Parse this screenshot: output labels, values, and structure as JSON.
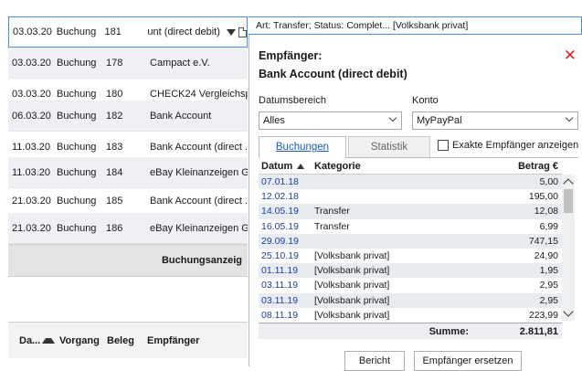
{
  "background": {
    "rows": [
      {
        "date": "03.03.20",
        "type": "Buchung",
        "num": "181",
        "payee": "unt (direct debit)"
      },
      {
        "date": "03.03.20",
        "type": "Buchung",
        "num": "178",
        "payee": "Campact e.V."
      },
      {
        "date": "03.03.20",
        "type": "Buchung",
        "num": "180",
        "payee": "CHECK24 Vergleichsp..."
      },
      {
        "date": "06.03.20",
        "type": "Buchung",
        "num": "182",
        "payee": "Bank Account"
      },
      {
        "date": "11.03.20",
        "type": "Buchung",
        "num": "183",
        "payee": "Bank Account (direct ..."
      },
      {
        "date": "11.03.20",
        "type": "Buchung",
        "num": "184",
        "payee": "eBay Kleinanzeigen G..."
      },
      {
        "date": "21.03.20",
        "type": "Buchung",
        "num": "185",
        "payee": "Bank Account (direct ..."
      },
      {
        "date": "21.03.20",
        "type": "Buchung",
        "num": "186",
        "payee": "eBay Kleinanzeigen G..."
      }
    ],
    "band_label": "Buchungsanzeig",
    "header": {
      "col1": "Da...",
      "col2": "Vorgang",
      "col3": "Beleg",
      "col4": "Empfänger"
    },
    "info_text": "Art: Transfer; Status: Complet...   [Volksbank privat]"
  },
  "popup": {
    "title": "Empfänger:",
    "subtitle": "Bank Account (direct debit)",
    "range_label": "Datumsbereich",
    "range_value": "Alles",
    "account_label": "Konto",
    "account_value": "MyPayPal",
    "tab_bookings": "Buchungen",
    "tab_stats": "Statistik",
    "checkbox_label": "Exakte Empfänger anzeigen",
    "table": {
      "headers": {
        "date": "Datum",
        "category": "Kategorie",
        "amount": "Betrag €"
      },
      "rows": [
        {
          "date": "07.01.18",
          "category": "",
          "amount": "5,00"
        },
        {
          "date": "12.02.18",
          "category": "",
          "amount": "195,00"
        },
        {
          "date": "14.05.19",
          "category": "Transfer",
          "amount": "12,08"
        },
        {
          "date": "16.05.19",
          "category": "Transfer",
          "amount": "6,99"
        },
        {
          "date": "29.09.19",
          "category": "",
          "amount": "747,15"
        },
        {
          "date": "25.10.19",
          "category": "[Volksbank privat]",
          "amount": "24,90"
        },
        {
          "date": "01.11.19",
          "category": "[Volksbank privat]",
          "amount": "1,95"
        },
        {
          "date": "03.11.19",
          "category": "[Volksbank privat]",
          "amount": "2,95"
        },
        {
          "date": "03.11.19",
          "category": "[Volksbank privat]",
          "amount": "2,95"
        },
        {
          "date": "08.11.19",
          "category": "[Volksbank privat]",
          "amount": "223,99"
        }
      ],
      "sum_label": "Summe:",
      "sum_value": "2.811,81"
    },
    "btn_report": "Bericht",
    "btn_replace": "Empfänger ersetzen"
  }
}
